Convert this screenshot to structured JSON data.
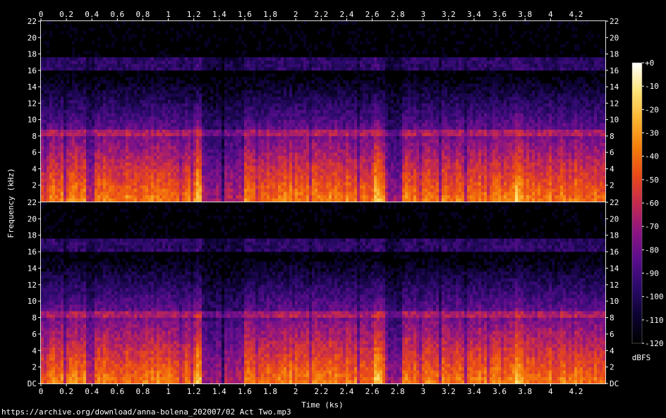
{
  "source_url": "https://archive.org/download/anna-bolena_202007/02 Act Two.mp3",
  "chart_data": {
    "type": "heatmap",
    "title": "",
    "xlabel": "Time (ks)",
    "ylabel": "Frequency (kHz)",
    "xlim": [
      0,
      4.43
    ],
    "ylim": [
      0,
      22
    ],
    "x_ticks": [
      "0",
      "0.2",
      "0.4",
      "0.6",
      "0.8",
      "1",
      "1.2",
      "1.4",
      "1.6",
      "1.8",
      "2",
      "2.2",
      "2.4",
      "2.6",
      "2.8",
      "3",
      "3.2",
      "3.4",
      "3.6",
      "3.8",
      "4",
      "4.2"
    ],
    "x_tick_values": [
      0,
      0.2,
      0.4,
      0.6,
      0.8,
      1.0,
      1.2,
      1.4,
      1.6,
      1.8,
      2.0,
      2.2,
      2.4,
      2.6,
      2.8,
      3.0,
      3.2,
      3.4,
      3.6,
      3.8,
      4.0,
      4.2
    ],
    "y_ticks": [
      "DC",
      "2",
      "4",
      "6",
      "8",
      "10",
      "12",
      "14",
      "16",
      "18",
      "20",
      "22"
    ],
    "y_tick_values": [
      0,
      2,
      4,
      6,
      8,
      10,
      12,
      14,
      16,
      18,
      20,
      22
    ],
    "channels": [
      "upper",
      "lower"
    ],
    "colorbar": {
      "label": "dBFS",
      "ticks": [
        "+0",
        "-10",
        "-20",
        "-30",
        "-40",
        "-50",
        "-60",
        "-70",
        "-80",
        "-90",
        "-100",
        "-110",
        "-120"
      ],
      "tick_values": [
        0,
        -10,
        -20,
        -30,
        -40,
        -50,
        -60,
        -70,
        -80,
        -90,
        -100,
        -110,
        -120
      ],
      "range": [
        -120,
        0
      ],
      "colors": [
        "#000000",
        "#0c0330",
        "#2b0a6b",
        "#5a0d8c",
        "#8e1582",
        "#c62a4e",
        "#ea4a17",
        "#f67f0a",
        "#fbb531",
        "#fde57a",
        "#ffffff"
      ]
    },
    "quiet_intervals_ks": [
      [
        0.35,
        0.43
      ],
      [
        1.27,
        1.6
      ],
      [
        2.7,
        2.83
      ]
    ],
    "loud_moments_ks": [
      1.24,
      2.65,
      3.75
    ]
  }
}
